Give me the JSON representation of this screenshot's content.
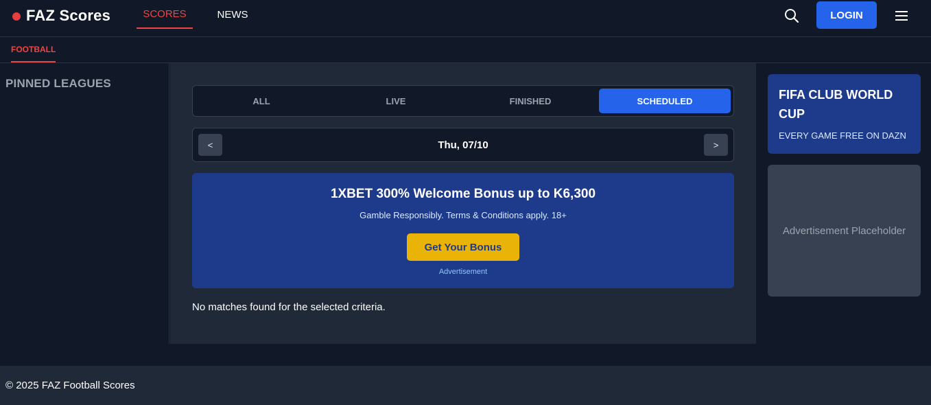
{
  "header": {
    "logo_text": "FAZ Scores",
    "nav": [
      {
        "label": "SCORES",
        "active": true
      },
      {
        "label": "NEWS",
        "active": false
      }
    ],
    "login_label": "LOGIN",
    "icons": {
      "search": "search-icon",
      "menu": "hamburger-menu-icon",
      "logo_dot": "red-dot-icon"
    }
  },
  "sport_tabs": [
    {
      "label": "FOOTBALL",
      "active": true
    }
  ],
  "left_sidebar": {
    "title": "PINNED LEAGUES"
  },
  "main": {
    "filter_tabs": [
      {
        "label": "ALL",
        "active": false
      },
      {
        "label": "LIVE",
        "active": false
      },
      {
        "label": "FINISHED",
        "active": false
      },
      {
        "label": "SCHEDULED",
        "active": true
      }
    ],
    "date_nav": {
      "prev_label": "<",
      "date": "Thu, 07/10",
      "next_label": ">"
    },
    "promo": {
      "title": "1XBET 300% Welcome Bonus up to K6,300",
      "subtitle": "Gamble Responsibly. Terms & Conditions apply. 18+",
      "button_label": "Get Your Bonus",
      "ad_label": "Advertisement"
    },
    "empty_message": "No matches found for the selected criteria."
  },
  "right_sidebar": {
    "promo_card": {
      "title": "FIFA CLUB WORLD CUP",
      "subtitle": "EVERY GAME FREE ON DAZN"
    },
    "ad_placeholder": "Advertisement Placeholder"
  },
  "footer": {
    "copyright": "© 2025 FAZ Football Scores"
  },
  "colors": {
    "background": "#111827",
    "panel": "#1f2937",
    "accent_red": "#ef4444",
    "primary_blue": "#2563eb",
    "promo_blue": "#1e3a8a",
    "bonus_yellow": "#eab308"
  }
}
